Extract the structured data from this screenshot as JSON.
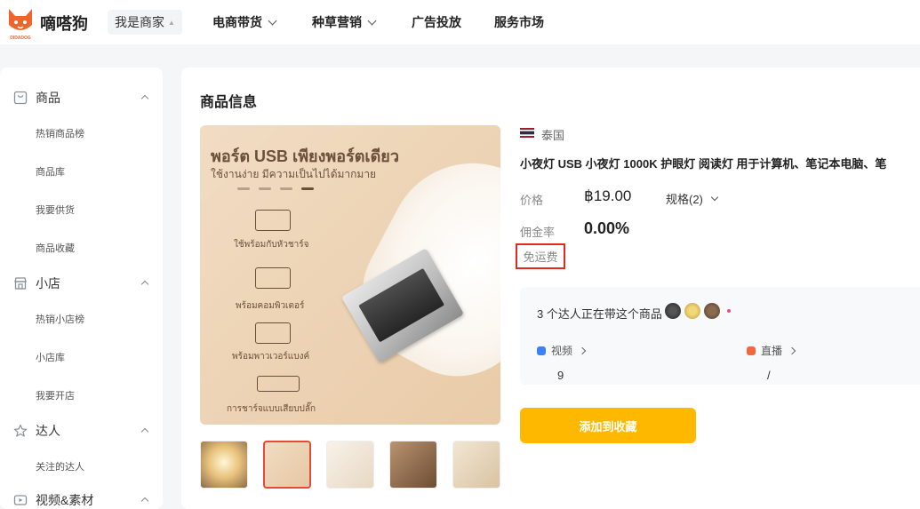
{
  "app": {
    "brand": "嘀嗒狗",
    "logo_caption": "DIDADOG",
    "merchant_label": "我是商家"
  },
  "nav": {
    "items": [
      {
        "label": "电商带货",
        "has_dropdown": true
      },
      {
        "label": "种草营销",
        "has_dropdown": true
      },
      {
        "label": "广告投放",
        "has_dropdown": false
      },
      {
        "label": "服务市场",
        "has_dropdown": false
      }
    ]
  },
  "sidebar": {
    "groups": [
      {
        "label": "商品",
        "icon": "bag-icon",
        "items": [
          "热销商品榜",
          "商品库",
          "我要供货",
          "商品收藏"
        ]
      },
      {
        "label": "小店",
        "icon": "shop-icon",
        "items": [
          "热销小店榜",
          "小店库",
          "我要开店"
        ]
      },
      {
        "label": "达人",
        "icon": "star-icon",
        "items": [
          "关注的达人"
        ]
      },
      {
        "label": "视频&素材",
        "icon": "video-icon",
        "items": []
      }
    ]
  },
  "main": {
    "title": "商品信息",
    "hero": {
      "headline": "พอร์ต USB เพียงพอร์ตเดียว",
      "subline": "ใช้งานง่าย มีความเป็นไปได้มากมาย",
      "rows": [
        "ใช้พร้อมกับหัวชาร์จ",
        "พร้อมคอมพิวเตอร์",
        "พร้อมพาวเวอร์แบงค์",
        "การชาร์จแบบเสียบปลั๊ก"
      ]
    },
    "thumbnails": {
      "count": 5,
      "selected_index": 1
    },
    "product": {
      "country": "泰国",
      "title": "小夜灯 USB 小夜灯 1000K 护眼灯 阅读灯 用于计算机、笔记本电脑、笔",
      "price_label": "价格",
      "price": "฿19.00",
      "spec_label": "规格(2)",
      "commission_label": "佣金率",
      "commission": "0.00%",
      "free_shipping_label": "免运费"
    },
    "creators": {
      "headline": "3 个达人正在带这个商品",
      "video_label": "视频",
      "video_count": "9",
      "live_label": "直播",
      "live_count": "/"
    },
    "add_button_label": "添加到收藏"
  },
  "colors": {
    "accent": "#ffb800",
    "highlight_border": "#e02a22",
    "video_icon": "#3b82f6",
    "live_icon": "#f2683c"
  }
}
